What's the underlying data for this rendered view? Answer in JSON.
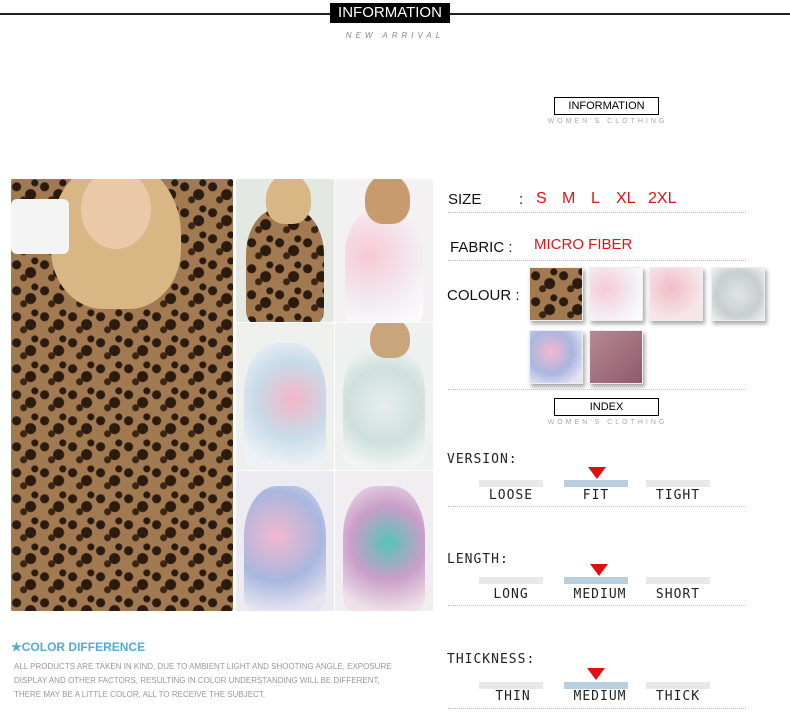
{
  "banner": {
    "title": "INFORMATION",
    "subtitle": "NEW ARRIVAL"
  },
  "info_heading": {
    "title": "INFORMATION",
    "subtitle": "WOMEN'S CLOTHING"
  },
  "index_heading": {
    "title": "INDEX",
    "subtitle": "WOMEN'S CLOTHING"
  },
  "spec": {
    "size_label": "SIZE",
    "size_sep": ":",
    "sizes": [
      "S",
      "M",
      "L",
      "XL",
      "2XL"
    ],
    "fabric_label": "FABRIC :",
    "fabric_value": "MICRO FIBER",
    "colour_label": "COLOUR :"
  },
  "swatches": [
    "leopard",
    "pink-tie-dye",
    "rose-tie-dye",
    "grey-tie-dye",
    "blue-pink-tie-dye",
    "wine"
  ],
  "version": {
    "title": "VERSION:",
    "options": [
      "LOOSE",
      "FIT",
      "TIGHT"
    ],
    "selected": "FIT"
  },
  "length": {
    "title": "LENGTH:",
    "options": [
      "LONG",
      "MEDIUM",
      "SHORT"
    ],
    "selected": "MEDIUM"
  },
  "thickness": {
    "title": "THICKNESS:",
    "options": [
      "THIN",
      "MEDIUM",
      "THICK"
    ],
    "selected": "MEDIUM"
  },
  "color_difference": {
    "title": "★COLOR DIFFERENCE",
    "line1": "ALL PRODUCTS ARE TAKEN IN KIND, DUE TO AMBIENT LIGHT AND SHOOTING ANGLE, EXPOSURE",
    "line2": "DISPLAY AND OTHER FACTORS, RESULTING IN COLOR UNDERSTANDING WILL BE DIFFERENT,",
    "line3": "THERE MAY BE A LITTLE COLOR, ALL TO RECEIVE THE SUBJECT."
  },
  "colors": {
    "accent_red": "#e01414",
    "accent_blue": "#57a9d6",
    "scale_active": "#b9cfdf"
  }
}
